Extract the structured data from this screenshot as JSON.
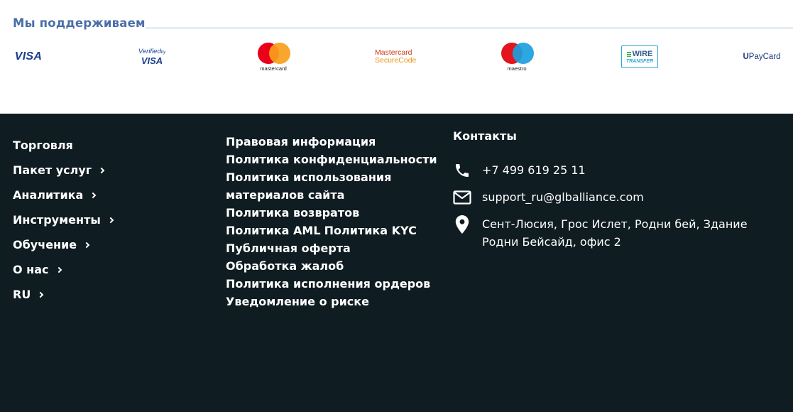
{
  "support": {
    "title": "Мы поддерживаем",
    "logos": {
      "visa": "VISA",
      "verified_by_visa": {
        "line1": "Verified",
        "line1_small": "by",
        "line2": "VISA"
      },
      "mastercard": {
        "caption": "mastercard",
        "colors": [
          "#eb001b",
          "#f79e1b"
        ]
      },
      "mastercard_securecode": {
        "line1": "Mastercard",
        "line2": "SecureCode"
      },
      "maestro": {
        "caption": "maestro",
        "colors": [
          "#e2141c",
          "#1ba0e0"
        ]
      },
      "wire_transfer": {
        "line1": "WIRE",
        "line2": "TRANSFER"
      },
      "upaycard": {
        "prefix": "U",
        "rest": "PayCard"
      }
    }
  },
  "footer": {
    "background": "#0f1c21",
    "nav": [
      {
        "label": "Торговля",
        "has_chevron": false
      },
      {
        "label": "Пакет услуг",
        "has_chevron": true
      },
      {
        "label": "Аналитика",
        "has_chevron": true
      },
      {
        "label": "Инструменты",
        "has_chevron": true
      },
      {
        "label": "Обучение",
        "has_chevron": true
      },
      {
        "label": "О нас",
        "has_chevron": true
      },
      {
        "label": "RU",
        "has_chevron": true
      }
    ],
    "legal": [
      "Правовая информация",
      "Политика конфиденциальности",
      "Политика использования материалов сайта",
      "Политика возвратов",
      "Политика AML",
      "Политика KYC",
      "Публичная оферта",
      "Обработка жалоб",
      "Политика исполнения ордеров",
      "Уведомление о риске"
    ],
    "contacts": {
      "title": "Контакты",
      "phone": {
        "icon": "phone-icon",
        "value": "+7 499 619 25 11"
      },
      "email": {
        "icon": "envelope-icon",
        "value": "support_ru@glballiance.com"
      },
      "address": {
        "icon": "map-pin-icon",
        "value": "Сент-Люсия, Грос Ислет, Родни бей, Здание Родни Бейсайд, офис 2"
      }
    }
  }
}
